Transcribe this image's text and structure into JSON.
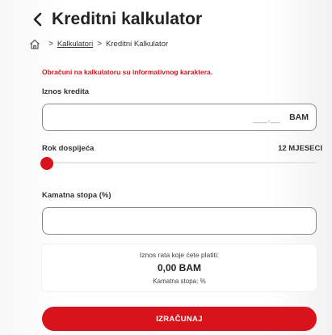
{
  "header": {
    "title": "Kreditni kalkulator"
  },
  "breadcrumb": {
    "link": "Kalkulatori",
    "current": "Kreditni Kalkulator",
    "separator": ">"
  },
  "disclaimer": "Obračuni na kalkulatoru su informativnog karaktera.",
  "amount": {
    "label": "Iznos kredita",
    "mask": "___,__",
    "currency": "BAM"
  },
  "term": {
    "label": "Rok dospijeća",
    "value": "12 MJESECI"
  },
  "rate": {
    "label": "Kamatna stopa (%)",
    "value": ""
  },
  "result": {
    "caption": "Iznos rata koje ćete platiti:",
    "amount": "0,00 BAM",
    "rate": "Kamatna stopa: %"
  },
  "button": {
    "label": "IZRAČUNAJ"
  },
  "colors": {
    "accent": "#d8131b"
  },
  "icons": {
    "back": "chevron-left-icon",
    "home": "home-icon"
  }
}
